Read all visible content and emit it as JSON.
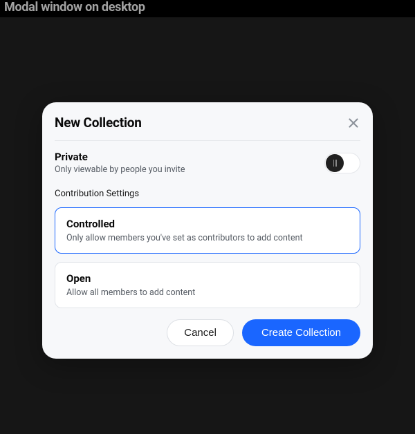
{
  "page": {
    "header": "Modal window on desktop"
  },
  "modal": {
    "title": "New Collection",
    "private": {
      "title": "Private",
      "description": "Only viewable by people you invite",
      "enabled": false
    },
    "contribution": {
      "label": "Contribution Settings",
      "options": [
        {
          "title": "Controlled",
          "description": "Only allow members you've set as contributors to add content",
          "selected": true
        },
        {
          "title": "Open",
          "description": "Allow all members to add content",
          "selected": false
        }
      ]
    },
    "buttons": {
      "cancel": "Cancel",
      "create": "Create Collection"
    }
  }
}
